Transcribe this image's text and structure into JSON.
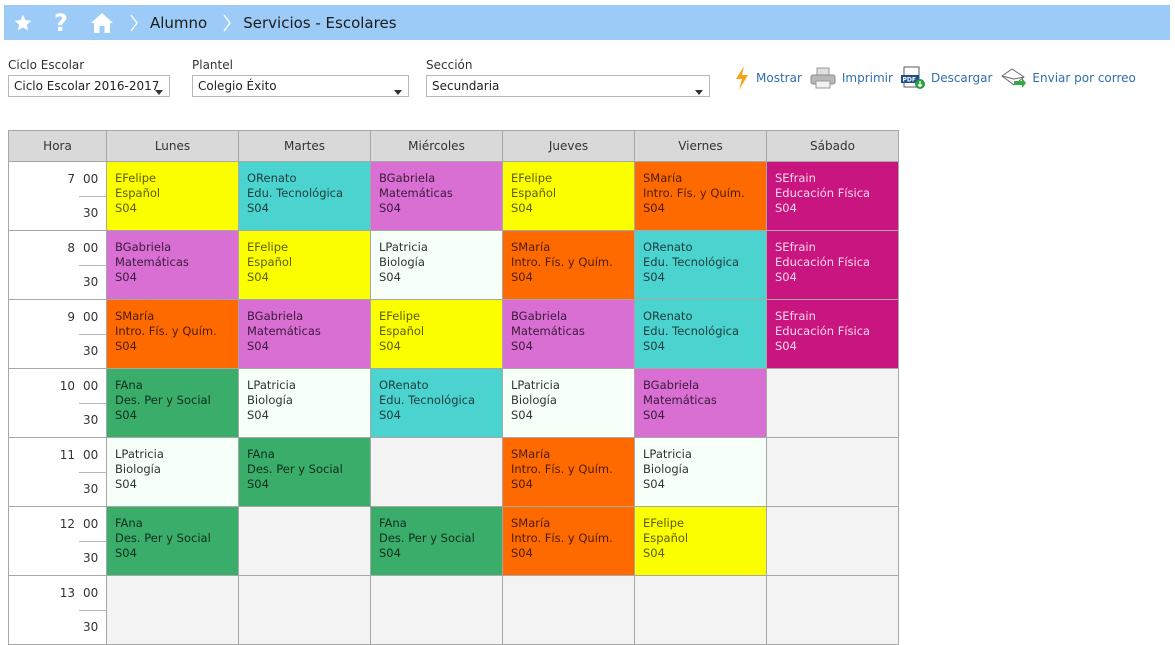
{
  "nav": {
    "icons": [
      "star-icon",
      "help-icon",
      "home-icon"
    ],
    "help_glyph": "?",
    "breadcrumb": [
      "Alumno",
      "Servicios - Escolares"
    ]
  },
  "filters": {
    "ciclo": {
      "label": "Ciclo Escolar",
      "value": "Ciclo Escolar 2016-2017"
    },
    "plantel": {
      "label": "Plantel",
      "value": "Colegio Éxito"
    },
    "seccion": {
      "label": "Sección",
      "value": "Secundaria"
    }
  },
  "actions": [
    {
      "label": "Mostrar",
      "icon": "lightning-icon"
    },
    {
      "label": "Imprimir",
      "icon": "printer-icon"
    },
    {
      "label": "Descargar",
      "icon": "pdf-download-icon"
    },
    {
      "label": "Enviar por correo",
      "icon": "send-mail-icon"
    }
  ],
  "timetable": {
    "headers": [
      "Hora",
      "Lunes",
      "Martes",
      "Miércoles",
      "Jueves",
      "Viernes",
      "Sábado"
    ],
    "minutes": [
      "00",
      "30"
    ],
    "hours": [
      "7",
      "8",
      "9",
      "10",
      "11",
      "12",
      "13"
    ],
    "colors": {
      "yellow": "#fbff00",
      "cyan": "#4ad3cf",
      "violet": "#d96ed3",
      "orange": "#ff6a00",
      "magenta": "#c9157f",
      "green": "#3aad6b",
      "white": "#f7fff9"
    },
    "rows": [
      [
        {
          "teacher": "EFelipe",
          "subject": "Español",
          "room": "S04",
          "color": "yellow"
        },
        {
          "teacher": "ORenato",
          "subject": "Edu. Tecnológica",
          "room": "S04",
          "color": "cyan"
        },
        {
          "teacher": "BGabriela",
          "subject": "Matemáticas",
          "room": "S04",
          "color": "violet"
        },
        {
          "teacher": "EFelipe",
          "subject": "Español",
          "room": "S04",
          "color": "yellow"
        },
        {
          "teacher": "SMaría",
          "subject": "Intro. Fís. y Quím.",
          "room": "S04",
          "color": "orange"
        },
        {
          "teacher": "SEfrain",
          "subject": "Educación Física",
          "room": "S04",
          "color": "magenta"
        }
      ],
      [
        {
          "teacher": "BGabriela",
          "subject": "Matemáticas",
          "room": "S04",
          "color": "violet"
        },
        {
          "teacher": "EFelipe",
          "subject": "Español",
          "room": "S04",
          "color": "yellow"
        },
        {
          "teacher": "LPatricia",
          "subject": "Biología",
          "room": "S04",
          "color": "white"
        },
        {
          "teacher": "SMaría",
          "subject": "Intro. Fís. y Quím.",
          "room": "S04",
          "color": "orange"
        },
        {
          "teacher": "ORenato",
          "subject": "Edu. Tecnológica",
          "room": "S04",
          "color": "cyan"
        },
        {
          "teacher": "SEfrain",
          "subject": "Educación Física",
          "room": "S04",
          "color": "magenta"
        }
      ],
      [
        {
          "teacher": "SMaría",
          "subject": "Intro. Fís. y Quím.",
          "room": "S04",
          "color": "orange"
        },
        {
          "teacher": "BGabriela",
          "subject": "Matemáticas",
          "room": "S04",
          "color": "violet"
        },
        {
          "teacher": "EFelipe",
          "subject": "Español",
          "room": "S04",
          "color": "yellow"
        },
        {
          "teacher": "BGabriela",
          "subject": "Matemáticas",
          "room": "S04",
          "color": "violet"
        },
        {
          "teacher": "ORenato",
          "subject": "Edu. Tecnológica",
          "room": "S04",
          "color": "cyan"
        },
        {
          "teacher": "SEfrain",
          "subject": "Educación Física",
          "room": "S04",
          "color": "magenta"
        }
      ],
      [
        {
          "teacher": "FAna",
          "subject": "Des. Per y Social",
          "room": "S04",
          "color": "green"
        },
        {
          "teacher": "LPatricia",
          "subject": "Biología",
          "room": "S04",
          "color": "white"
        },
        {
          "teacher": "ORenato",
          "subject": "Edu. Tecnológica",
          "room": "S04",
          "color": "cyan"
        },
        {
          "teacher": "LPatricia",
          "subject": "Biología",
          "room": "S04",
          "color": "white"
        },
        {
          "teacher": "BGabriela",
          "subject": "Matemáticas",
          "room": "S04",
          "color": "violet"
        },
        null
      ],
      [
        {
          "teacher": "LPatricia",
          "subject": "Biología",
          "room": "S04",
          "color": "white"
        },
        {
          "teacher": "FAna",
          "subject": "Des. Per y Social",
          "room": "S04",
          "color": "green"
        },
        null,
        {
          "teacher": "SMaría",
          "subject": "Intro. Fís. y Quím.",
          "room": "S04",
          "color": "orange"
        },
        {
          "teacher": "LPatricia",
          "subject": "Biología",
          "room": "S04",
          "color": "white"
        },
        null
      ],
      [
        {
          "teacher": "FAna",
          "subject": "Des. Per y Social",
          "room": "S04",
          "color": "green"
        },
        null,
        {
          "teacher": "FAna",
          "subject": "Des. Per y Social",
          "room": "S04",
          "color": "green"
        },
        {
          "teacher": "SMaría",
          "subject": "Intro. Fís. y Quím.",
          "room": "S04",
          "color": "orange"
        },
        {
          "teacher": "EFelipe",
          "subject": "Español",
          "room": "S04",
          "color": "yellow"
        },
        null
      ],
      [
        null,
        null,
        null,
        null,
        null,
        null
      ]
    ]
  }
}
